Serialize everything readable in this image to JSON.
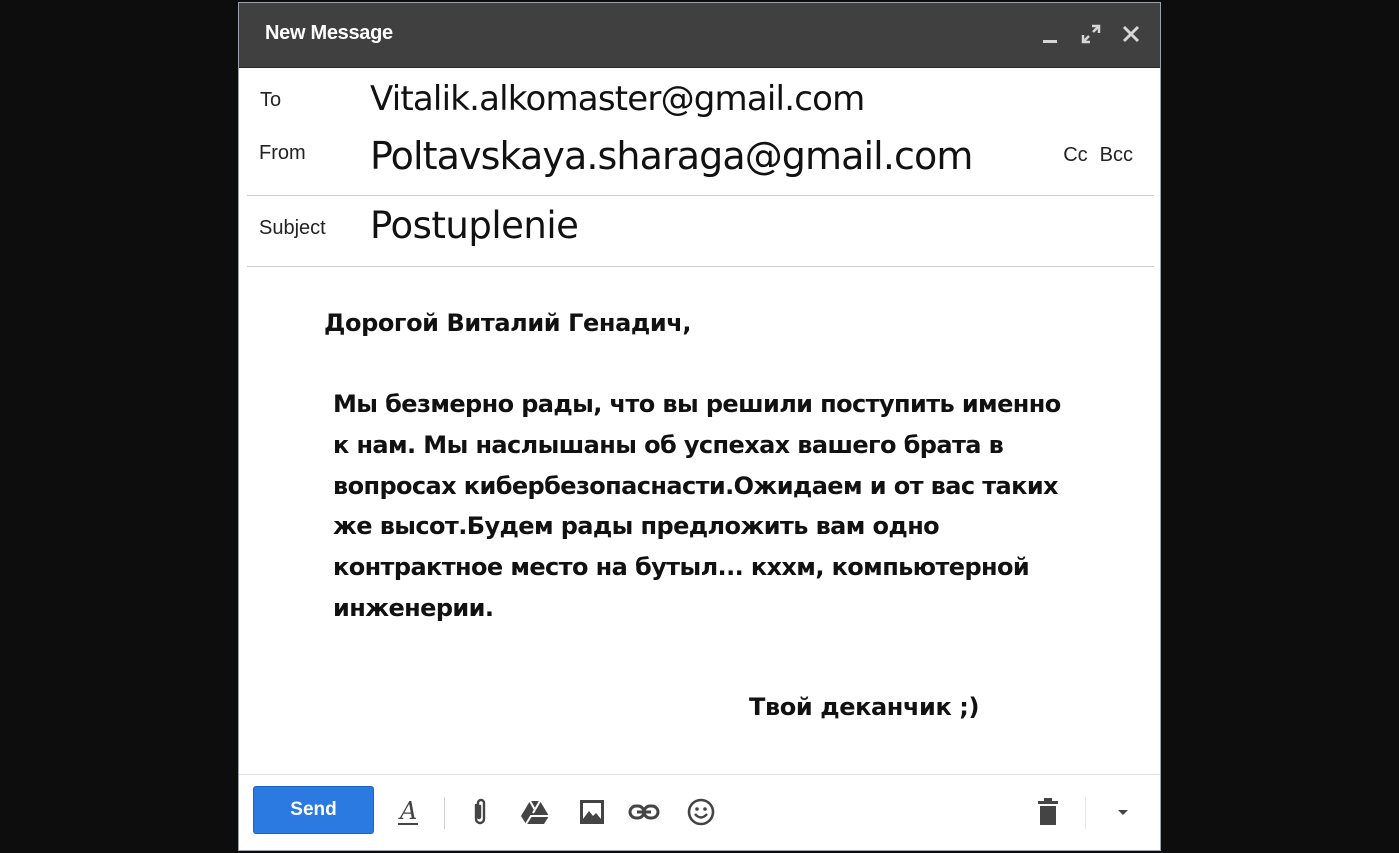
{
  "window": {
    "title": "New Message"
  },
  "header": {
    "to_label": "To",
    "to_value": "Vitalik.alkomaster@gmail.com",
    "from_label": "From",
    "from_value": "Poltavskaya.sharaga@gmail.com",
    "cc_label": "Cc",
    "bcc_label": "Bcc",
    "subject_label": "Subject",
    "subject_value": "Postuplenie"
  },
  "message": {
    "greeting": "Дорогой Виталий Генадич,",
    "body": "Мы безмерно рады, что вы решили поступить именно\nк нам. Мы наслышаны об успехах вашего брата в\nвопросах кибербезопаснасти.Ожидаем и от вас таких\nже высот.Будем рады предложить вам одно\nконтрактное место на бутыл... кххм, компьютерной\nинженерии.",
    "signature": "Твой деканчик ;)"
  },
  "toolbar": {
    "send_label": "Send",
    "send_color": "#2a7ae2",
    "icons": [
      "format-text-icon",
      "attach-icon",
      "drive-icon",
      "photo-icon",
      "link-icon",
      "emoji-icon",
      "trash-icon",
      "more-options-icon"
    ]
  }
}
